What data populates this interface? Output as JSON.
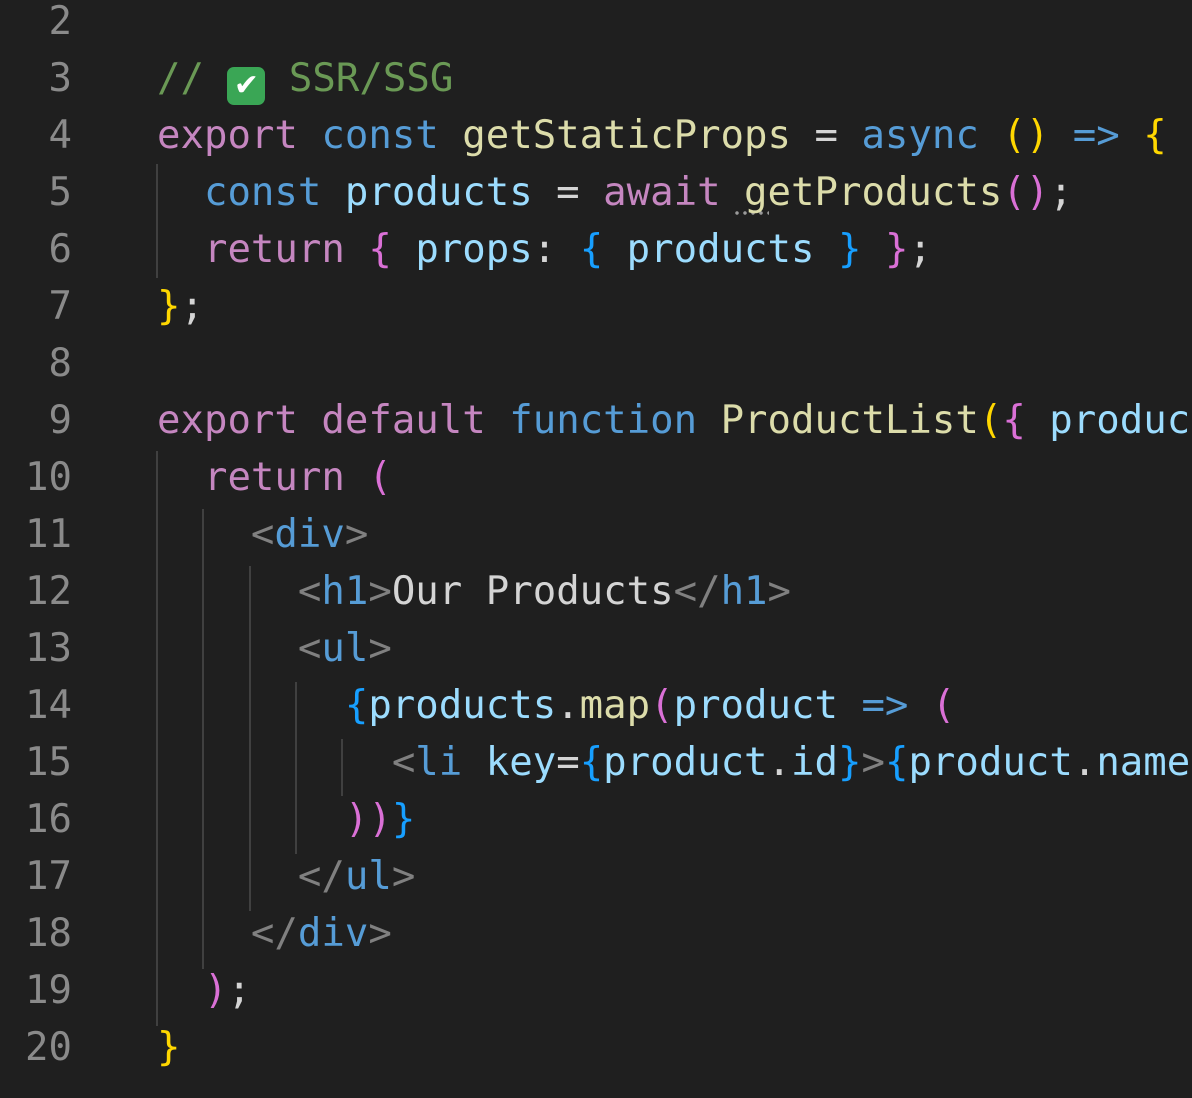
{
  "editor": {
    "lines": [
      {
        "num": "2",
        "tokens": []
      },
      {
        "num": "3",
        "tokens": [
          {
            "t": "// ",
            "c": "cm"
          },
          {
            "icon": "check-icon",
            "t": "✔"
          },
          {
            "t": " SSR/SSG",
            "c": "cm"
          }
        ]
      },
      {
        "num": "4",
        "tokens": [
          {
            "t": "export",
            "c": "kw"
          },
          {
            "t": " ",
            "c": "op"
          },
          {
            "t": "const",
            "c": "st"
          },
          {
            "t": " ",
            "c": "op"
          },
          {
            "t": "getStaticProps",
            "c": "fn"
          },
          {
            "t": " = ",
            "c": "op"
          },
          {
            "t": "async",
            "c": "st"
          },
          {
            "t": " ",
            "c": "op"
          },
          {
            "t": "()",
            "c": "b1"
          },
          {
            "t": " ",
            "c": "op"
          },
          {
            "t": "=>",
            "c": "st"
          },
          {
            "t": " ",
            "c": "op"
          },
          {
            "t": "{",
            "c": "b1"
          }
        ]
      },
      {
        "num": "5",
        "tokens": [
          {
            "t": "  ",
            "c": "op"
          },
          {
            "t": "const",
            "c": "st"
          },
          {
            "t": " ",
            "c": "op"
          },
          {
            "t": "products",
            "c": "vr"
          },
          {
            "t": " = ",
            "c": "op"
          },
          {
            "t": "await",
            "c": "kw"
          },
          {
            "t": " ",
            "c": "op"
          },
          {
            "t": "getProducts",
            "c": "fn"
          },
          {
            "t": "()",
            "c": "b2"
          },
          {
            "t": ";",
            "c": "op"
          }
        ]
      },
      {
        "num": "6",
        "tokens": [
          {
            "t": "  ",
            "c": "op"
          },
          {
            "t": "return",
            "c": "kw"
          },
          {
            "t": " ",
            "c": "op"
          },
          {
            "t": "{",
            "c": "b2"
          },
          {
            "t": " ",
            "c": "op"
          },
          {
            "t": "props",
            "c": "vr"
          },
          {
            "t": ": ",
            "c": "op"
          },
          {
            "t": "{",
            "c": "b3"
          },
          {
            "t": " ",
            "c": "op"
          },
          {
            "t": "products",
            "c": "vr"
          },
          {
            "t": " ",
            "c": "op"
          },
          {
            "t": "}",
            "c": "b3"
          },
          {
            "t": " ",
            "c": "op"
          },
          {
            "t": "}",
            "c": "b2"
          },
          {
            "t": ";",
            "c": "op"
          }
        ]
      },
      {
        "num": "7",
        "tokens": [
          {
            "t": "}",
            "c": "b1"
          },
          {
            "t": ";",
            "c": "op"
          }
        ]
      },
      {
        "num": "8",
        "tokens": []
      },
      {
        "num": "9",
        "tokens": [
          {
            "t": "export",
            "c": "kw"
          },
          {
            "t": " ",
            "c": "op"
          },
          {
            "t": "default",
            "c": "kw"
          },
          {
            "t": " ",
            "c": "op"
          },
          {
            "t": "function",
            "c": "st"
          },
          {
            "t": " ",
            "c": "op"
          },
          {
            "t": "ProductList",
            "c": "fn"
          },
          {
            "t": "(",
            "c": "b1"
          },
          {
            "t": "{",
            "c": "b2"
          },
          {
            "t": " ",
            "c": "op"
          },
          {
            "t": "product",
            "c": "vr"
          }
        ]
      },
      {
        "num": "10",
        "tokens": [
          {
            "t": "  ",
            "c": "op"
          },
          {
            "t": "return",
            "c": "kw"
          },
          {
            "t": " ",
            "c": "op"
          },
          {
            "t": "(",
            "c": "b2"
          }
        ]
      },
      {
        "num": "11",
        "tokens": [
          {
            "t": "    ",
            "c": "op"
          },
          {
            "t": "<",
            "c": "tg"
          },
          {
            "t": "div",
            "c": "tn"
          },
          {
            "t": ">",
            "c": "tg"
          }
        ]
      },
      {
        "num": "12",
        "tokens": [
          {
            "t": "      ",
            "c": "op"
          },
          {
            "t": "<",
            "c": "tg"
          },
          {
            "t": "h1",
            "c": "tn"
          },
          {
            "t": ">",
            "c": "tg"
          },
          {
            "t": "Our Products",
            "c": "tx"
          },
          {
            "t": "</",
            "c": "tg"
          },
          {
            "t": "h1",
            "c": "tn"
          },
          {
            "t": ">",
            "c": "tg"
          }
        ]
      },
      {
        "num": "13",
        "tokens": [
          {
            "t": "      ",
            "c": "op"
          },
          {
            "t": "<",
            "c": "tg"
          },
          {
            "t": "ul",
            "c": "tn"
          },
          {
            "t": ">",
            "c": "tg"
          }
        ]
      },
      {
        "num": "14",
        "tokens": [
          {
            "t": "        ",
            "c": "op"
          },
          {
            "t": "{",
            "c": "b3"
          },
          {
            "t": "products",
            "c": "vr"
          },
          {
            "t": ".",
            "c": "op"
          },
          {
            "t": "map",
            "c": "fn"
          },
          {
            "t": "(",
            "c": "b2"
          },
          {
            "t": "product",
            "c": "vr"
          },
          {
            "t": " ",
            "c": "op"
          },
          {
            "t": "=>",
            "c": "st"
          },
          {
            "t": " ",
            "c": "op"
          },
          {
            "t": "(",
            "c": "b2"
          }
        ]
      },
      {
        "num": "15",
        "tokens": [
          {
            "t": "          ",
            "c": "op"
          },
          {
            "t": "<",
            "c": "tg"
          },
          {
            "t": "li",
            "c": "tn"
          },
          {
            "t": " ",
            "c": "op"
          },
          {
            "t": "key",
            "c": "at"
          },
          {
            "t": "=",
            "c": "op"
          },
          {
            "t": "{",
            "c": "b3"
          },
          {
            "t": "product",
            "c": "vr"
          },
          {
            "t": ".",
            "c": "op"
          },
          {
            "t": "id",
            "c": "vr"
          },
          {
            "t": "}",
            "c": "b3"
          },
          {
            "t": ">",
            "c": "tg"
          },
          {
            "t": "{",
            "c": "b3"
          },
          {
            "t": "product",
            "c": "vr"
          },
          {
            "t": ".",
            "c": "op"
          },
          {
            "t": "name",
            "c": "vr"
          },
          {
            "t": "}",
            "c": "b3"
          }
        ]
      },
      {
        "num": "16",
        "tokens": [
          {
            "t": "        ",
            "c": "op"
          },
          {
            "t": "))",
            "c": "b2"
          },
          {
            "t": "}",
            "c": "b3"
          }
        ]
      },
      {
        "num": "17",
        "tokens": [
          {
            "t": "      ",
            "c": "op"
          },
          {
            "t": "</",
            "c": "tg"
          },
          {
            "t": "ul",
            "c": "tn"
          },
          {
            "t": ">",
            "c": "tg"
          }
        ]
      },
      {
        "num": "18",
        "tokens": [
          {
            "t": "    ",
            "c": "op"
          },
          {
            "t": "</",
            "c": "tg"
          },
          {
            "t": "div",
            "c": "tn"
          },
          {
            "t": ">",
            "c": "tg"
          }
        ]
      },
      {
        "num": "19",
        "tokens": [
          {
            "t": "  ",
            "c": "op"
          },
          {
            "t": ")",
            "c": "b2"
          },
          {
            "t": ";",
            "c": "op"
          }
        ]
      },
      {
        "num": "20",
        "tokens": [
          {
            "t": "}",
            "c": "b1"
          }
        ]
      }
    ]
  }
}
